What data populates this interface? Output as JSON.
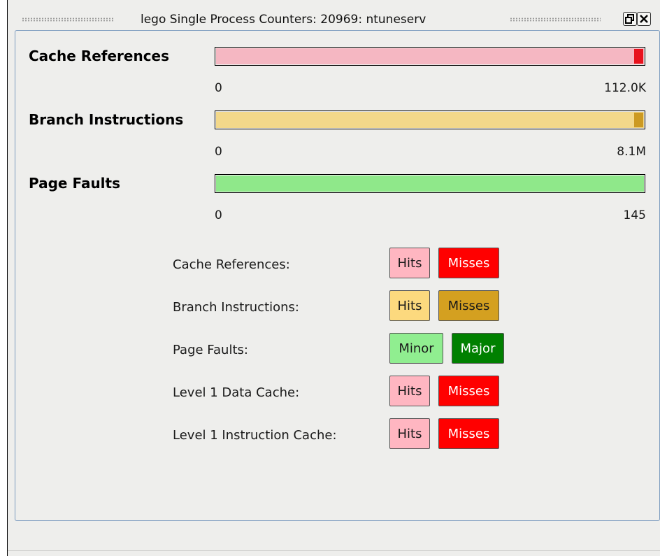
{
  "window": {
    "title": "lego Single Process Counters: 20969: ntuneserv",
    "float_icon": "float-icon",
    "close_icon": "close-icon"
  },
  "meters": [
    {
      "label": "Cache References",
      "min": "0",
      "max": "112.0K",
      "fill_color": "#f5b7c2",
      "end_color": "#e8121d",
      "level": 1.0
    },
    {
      "label": "Branch Instructions",
      "min": "0",
      "max": "8.1M",
      "fill_color": "#f3d88a",
      "end_color": "#cc9a22",
      "level": 1.0
    },
    {
      "label": "Page Faults",
      "min": "0",
      "max": "145",
      "fill_color": "#8fe88a",
      "end_color": "#8fe88a",
      "level": 1.0
    }
  ],
  "legend": [
    {
      "label": "Cache References:",
      "a": {
        "text": "Hits",
        "bg": "#ffb6c1",
        "fg": "#1a1a1a"
      },
      "b": {
        "text": "Misses",
        "bg": "#ff0000",
        "fg": "#ffffff"
      }
    },
    {
      "label": "Branch Instructions:",
      "a": {
        "text": "Hits",
        "bg": "#fcd97e",
        "fg": "#1a1a1a"
      },
      "b": {
        "text": "Misses",
        "bg": "#d4a020",
        "fg": "#1a1a1a"
      }
    },
    {
      "label": "Page Faults:",
      "a": {
        "text": "Minor",
        "bg": "#90ee90",
        "fg": "#1a1a1a"
      },
      "b": {
        "text": "Major",
        "bg": "#008000",
        "fg": "#ffffff"
      }
    },
    {
      "label": "Level 1 Data Cache:",
      "a": {
        "text": "Hits",
        "bg": "#ffb6c1",
        "fg": "#1a1a1a"
      },
      "b": {
        "text": "Misses",
        "bg": "#ff0000",
        "fg": "#ffffff"
      }
    },
    {
      "label": "Level 1 Instruction Cache:",
      "a": {
        "text": "Hits",
        "bg": "#ffb6c1",
        "fg": "#1a1a1a"
      },
      "b": {
        "text": "Misses",
        "bg": "#ff0000",
        "fg": "#ffffff"
      }
    }
  ]
}
